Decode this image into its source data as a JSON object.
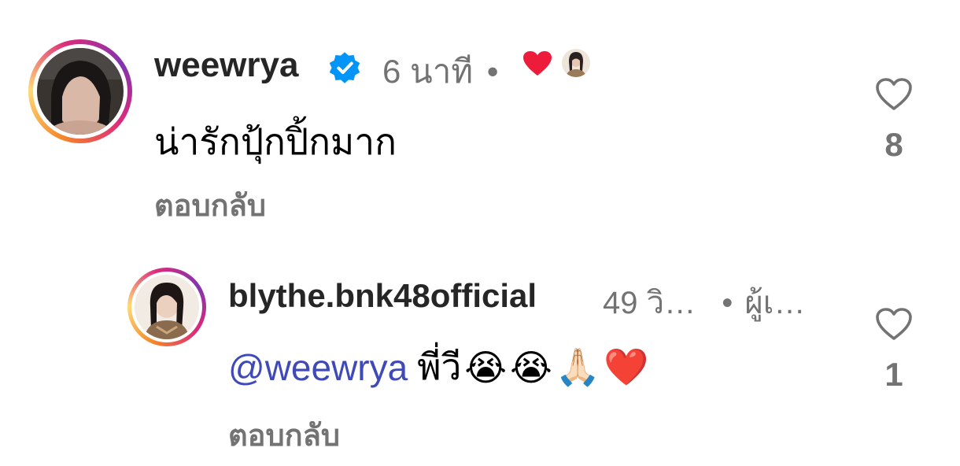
{
  "comments": [
    {
      "username": "weewrya",
      "verified": true,
      "time": "6 นาที",
      "separator": "•",
      "text": "น่ารักปุ้กปิ้กมาก",
      "reply_label": "ตอบกลับ",
      "like_count": "8",
      "liked_by_author": true
    },
    {
      "username": "blythe.bnk48official",
      "time": "49 วิ…",
      "separator": "•",
      "author_tag": "ผู้เ…",
      "mention": "@weewrya",
      "text": "พี่วี",
      "emojis": [
        "😭",
        "😭",
        "🙏🏻",
        "❤️"
      ],
      "reply_label": "ตอบกลับ",
      "like_count": "1"
    }
  ],
  "colors": {
    "text_primary": "#262626",
    "text_secondary": "#737373",
    "mention": "#3f4ab8",
    "verified_badge": "#0095f6",
    "heart_red": "#ed1c3b"
  }
}
